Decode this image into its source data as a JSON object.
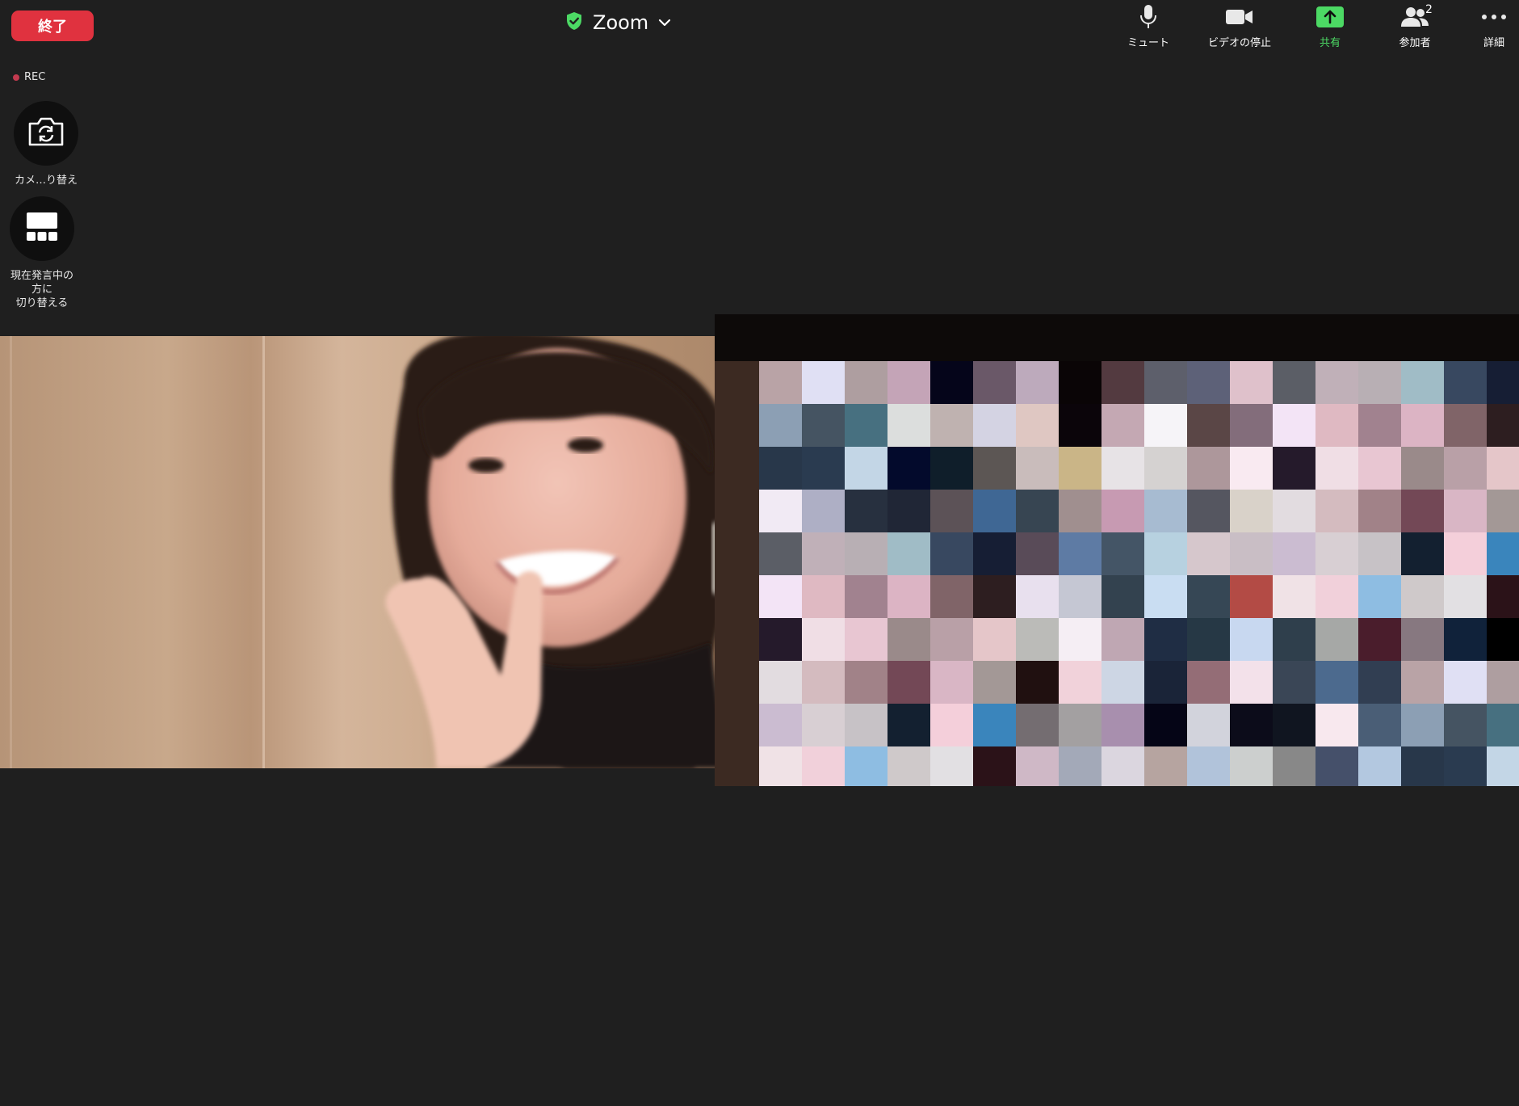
{
  "top_bar": {
    "end_label": "終了",
    "title": "Zoom",
    "toolbar": {
      "mute": {
        "label": "ミュート",
        "icon": "microphone-icon"
      },
      "video": {
        "label": "ビデオの停止",
        "icon": "video-camera-icon"
      },
      "share": {
        "label": "共有",
        "icon": "share-screen-icon"
      },
      "participants": {
        "label": "参加者",
        "icon": "participants-icon",
        "count": "2"
      },
      "more": {
        "label": "詳細",
        "icon": "more-icon"
      }
    }
  },
  "rec": {
    "label": "REC"
  },
  "side_controls": {
    "switch_camera": {
      "label": "カメ…り替え",
      "icon": "switch-camera-icon"
    },
    "speaker_view": {
      "label": "現在発言中の\n方に\n切り替える",
      "icon": "speaker-view-icon"
    }
  },
  "colors": {
    "background": "#1f1f1f",
    "end_button": "#e0323f",
    "share_accent": "#4cd964",
    "shield": "#4cd964",
    "rec_dot": "#c23a4f"
  }
}
